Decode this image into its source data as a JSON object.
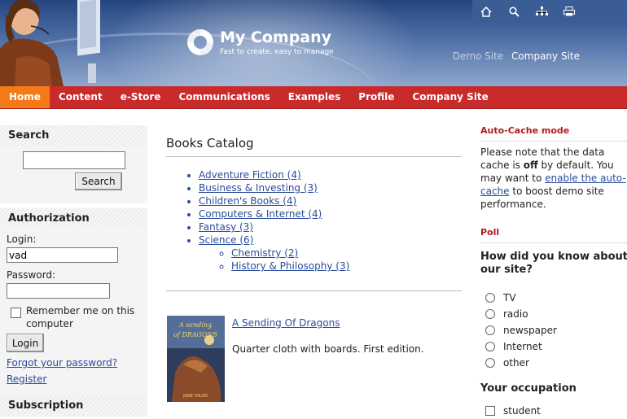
{
  "header": {
    "company_name": "My Company",
    "slogan": "Fast to create, easy to manage",
    "sites": [
      "Demo Site",
      "Company Site"
    ],
    "toolbar_icons": [
      "home-icon",
      "search-icon",
      "sitemap-icon",
      "print-icon"
    ],
    "colors": {
      "header_bg": "#3b5d96",
      "nav_bg": "#c92a2a",
      "nav_active": "#f47a17"
    }
  },
  "nav": {
    "items": [
      "Home",
      "Content",
      "e-Store",
      "Communications",
      "Examples",
      "Profile",
      "Company Site"
    ],
    "active": "Home"
  },
  "search": {
    "title": "Search",
    "input_value": "",
    "button_label": "Search"
  },
  "auth": {
    "title": "Authorization",
    "login_label": "Login:",
    "login_value": "vad",
    "password_label": "Password:",
    "password_value": "",
    "remember_label": "Remember me on this computer",
    "login_button": "Login",
    "forgot_link": "Forgot your password?",
    "register_link": "Register"
  },
  "subscription": {
    "title": "Subscription"
  },
  "catalog": {
    "title": "Books Catalog",
    "categories": [
      "Adventure Fiction (4)",
      "Business & Investing (3)",
      "Children's Books (4)",
      "Computers & Internet (4)",
      "Fantasy (3)",
      "Science (6)"
    ],
    "subcategories": [
      "Chemistry (2)",
      "History & Philosophy (3)"
    ],
    "book": {
      "title": "A Sending Of Dragons",
      "description": "Quarter cloth with boards. First edition.",
      "cover_title": "A Sending of Dragons",
      "cover_author": "JANE YOLEN"
    }
  },
  "right": {
    "autocache_title": "Auto-Cache mode",
    "autocache_text_1": "Please note that the data cache is ",
    "autocache_bold": "off",
    "autocache_text_2": " by default. You may want to ",
    "autocache_link": "enable the auto-cache",
    "autocache_text_3": " to boost demo site performance.",
    "poll_title": "Poll",
    "poll_question": "How did you know about our site?",
    "poll_options": [
      "TV",
      "radio",
      "newspaper",
      "Internet",
      "other"
    ],
    "occupation_title": "Your occupation",
    "occupation_options": [
      "student"
    ]
  }
}
